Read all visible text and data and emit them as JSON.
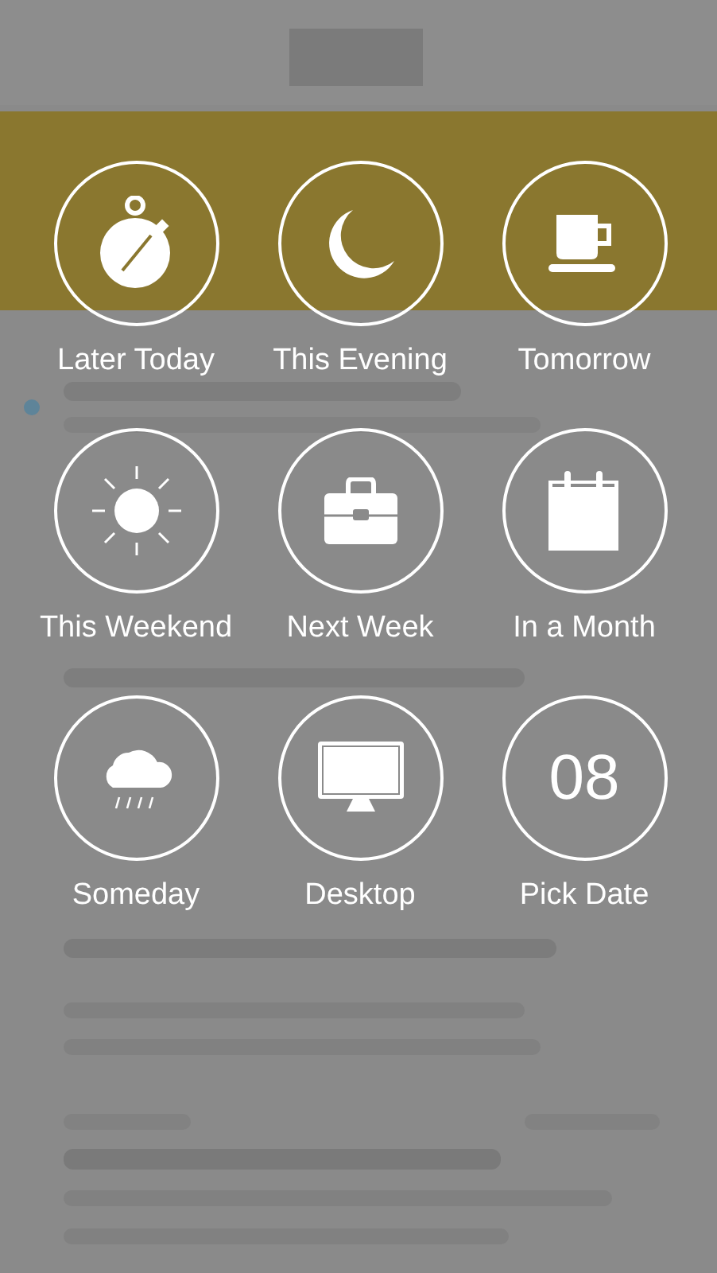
{
  "snooze_options": [
    {
      "label": "Later Today",
      "kind": "stopwatch"
    },
    {
      "label": "This Evening",
      "kind": "moon"
    },
    {
      "label": "Tomorrow",
      "kind": "cup"
    },
    {
      "label": "This Weekend",
      "kind": "sun"
    },
    {
      "label": "Next Week",
      "kind": "briefcase"
    },
    {
      "label": "In a Month",
      "kind": "calendar"
    },
    {
      "label": "Someday",
      "kind": "cloud"
    },
    {
      "label": "Desktop",
      "kind": "monitor"
    },
    {
      "label": "Pick Date",
      "kind": "date"
    }
  ],
  "pick_date_day": "08"
}
